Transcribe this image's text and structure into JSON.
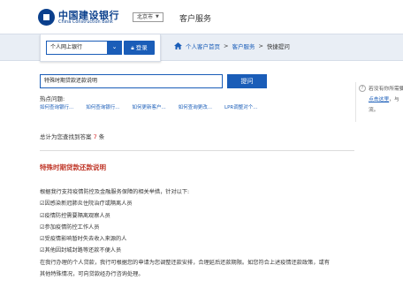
{
  "header": {
    "brand_cn": "中国建设银行",
    "brand_en": "China Construction Bank",
    "city": "北京市",
    "service_title": "客户服务"
  },
  "login": {
    "selected": "个人网上银行",
    "button": "登录"
  },
  "breadcrumb": [
    "个人客户首页",
    "客户服务",
    "快捷提问"
  ],
  "search": {
    "value": "特殊时期贷款还款说明",
    "button": "提问"
  },
  "hot": {
    "title": "热点问题:",
    "links": [
      "如何查询银行...",
      "如何查询银行...",
      "如何更新客户...",
      "如何查询更改...",
      "LPR调整对个..."
    ]
  },
  "total": {
    "prefix": "总计为您查找到答案",
    "count": "7",
    "suffix": "条"
  },
  "article": {
    "title": "特殊时期贷款还款说明",
    "lines": [
      "根据我行支持疫情防控及金融服务保障的相关举措，针对以下:",
      "☑因感染新冠肺炎住院治疗或隔离人员",
      "☑疫情防控需要隔离观察人员",
      "☑参加疫情防控工作人员",
      "☑受疫情影响暂时失去收入来源的人",
      "☑其他因封城封路等还款不便人员",
      "在我行办理的个人贷款，我行可根据您的申请为您调整还款安排，合理延后还款期限。如您符合上述疫情还款政策，或有",
      "其他特殊情况，可向贷款经办行咨询处理。"
    ]
  },
  "side": {
    "line1": "若没有你所需要",
    "link": "点击这里",
    "line2_rest": "，与",
    "line3": "流。"
  },
  "colors": {
    "brand_blue": "#0a3f8c",
    "button_blue": "#1a5db8",
    "title_red": "#c0392b",
    "nav_bg": "#e9eef5"
  }
}
